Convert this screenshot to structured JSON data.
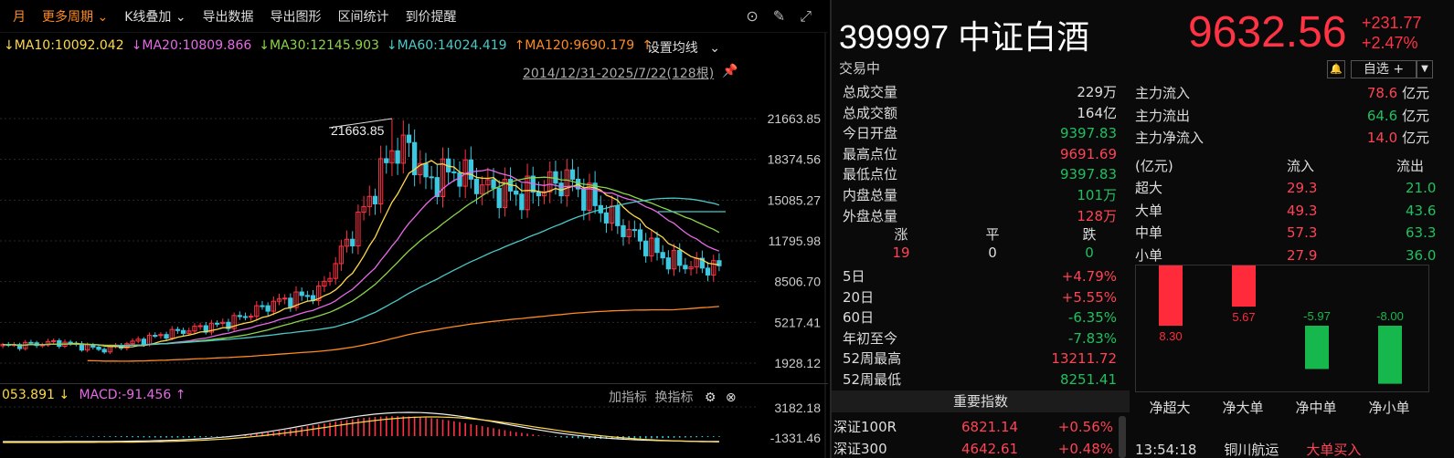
{
  "toolbar": {
    "period": "月",
    "more_period": "更多周期",
    "kline_overlay": "K线叠加",
    "export_data": "导出数据",
    "export_chart": "导出图形",
    "range_stats": "区间统计",
    "price_alert": "到价提醒"
  },
  "ma_legend": [
    {
      "label": "MA10:10092.042",
      "arrow": "↓",
      "color": "#ffd84a"
    },
    {
      "label": "MA20:10809.866",
      "arrow": "↓",
      "color": "#e66ae6"
    },
    {
      "label": "MA30:12145.903",
      "arrow": "↓",
      "color": "#8bd44a"
    },
    {
      "label": "MA60:14024.419",
      "arrow": "↓",
      "color": "#4ac8c8"
    },
    {
      "label": "MA120:9690.179",
      "arrow": "↑",
      "color": "#ff8a1f"
    }
  ],
  "ma_setting": "设置均线",
  "date_range": "2014/12/31-2025/7/22(128根)",
  "high_label": "21663.85",
  "price_axis": [
    "21663.85",
    "18374.56",
    "15085.27",
    "11795.98",
    "8506.70",
    "5217.41",
    "1928.12"
  ],
  "macd_axis": [
    "3182.18",
    "-1331.46"
  ],
  "macd_legend": {
    "prefix": "053.891",
    "prefix_arrow": "↓",
    "label": "MACD:-91.456",
    "arrow": "↑"
  },
  "lower_tools": {
    "add": "加指标",
    "swap": "换指标"
  },
  "header": {
    "code": "399997 中证白酒",
    "price": "9632.56",
    "change": "+231.77",
    "change_pct": "+2.47%",
    "status": "交易中",
    "watchlist": "自选 +"
  },
  "stats": [
    {
      "k": "总成交量",
      "v": "229万",
      "c": "white"
    },
    {
      "k": "总成交额",
      "v": "164亿",
      "c": "white"
    },
    {
      "k": "今日开盘",
      "v": "9397.83",
      "c": "green"
    },
    {
      "k": "最高点位",
      "v": "9691.69",
      "c": "red"
    },
    {
      "k": "最低点位",
      "v": "9397.83",
      "c": "green"
    },
    {
      "k": "内盘总量",
      "v": "101万",
      "c": "green"
    },
    {
      "k": "外盘总量",
      "v": "128万",
      "c": "red"
    }
  ],
  "updown": {
    "labels": [
      "涨",
      "平",
      "跌"
    ],
    "values": [
      "19",
      "0",
      "0"
    ]
  },
  "periods": [
    {
      "k": "5日",
      "v": "+4.79%",
      "c": "red"
    },
    {
      "k": "20日",
      "v": "+5.55%",
      "c": "red"
    },
    {
      "k": "60日",
      "v": "-6.35%",
      "c": "green"
    },
    {
      "k": "年初至今",
      "v": "-7.83%",
      "c": "green"
    },
    {
      "k": "52周最高",
      "v": "13211.72",
      "c": "red"
    },
    {
      "k": "52周最低",
      "v": "8251.41",
      "c": "green"
    }
  ],
  "main_flow": [
    {
      "k": "主力流入",
      "v": "78.6",
      "unit": "亿元",
      "c": "red"
    },
    {
      "k": "主力流出",
      "v": "64.6",
      "unit": "亿元",
      "c": "green"
    },
    {
      "k": "主力净流入",
      "v": "14.0",
      "unit": "亿元",
      "c": "red"
    }
  ],
  "flow_table": {
    "headers": [
      "(亿元)",
      "流入",
      "流出"
    ],
    "rows": [
      [
        "超大",
        "29.3",
        "21.0"
      ],
      [
        "大单",
        "49.3",
        "43.6"
      ],
      [
        "中单",
        "57.3",
        "63.3"
      ],
      [
        "小单",
        "27.9",
        "36.0"
      ]
    ]
  },
  "net_flow": {
    "bars": [
      {
        "label": "净超大",
        "value": 8.3,
        "text": "8.30"
      },
      {
        "label": "净大单",
        "value": 5.67,
        "text": "5.67"
      },
      {
        "label": "净中单",
        "value": -5.97,
        "text": "-5.97"
      },
      {
        "label": "净小单",
        "value": -8.0,
        "text": "-8.00"
      }
    ],
    "up_color": "#ff2a3a",
    "down_color": "#16b84e"
  },
  "index_header": "重要指数",
  "indices": [
    {
      "name": "深证100R",
      "val": "6821.14",
      "pct": "+0.56%"
    },
    {
      "name": "深证300",
      "val": "4642.61",
      "pct": "+0.48%"
    }
  ],
  "ticker": [
    "13:54:18",
    "铜川航运",
    "大单买入"
  ],
  "colors": {
    "up": "#ff4455",
    "down": "#20c060",
    "ma120": "#ff8a1f"
  }
}
